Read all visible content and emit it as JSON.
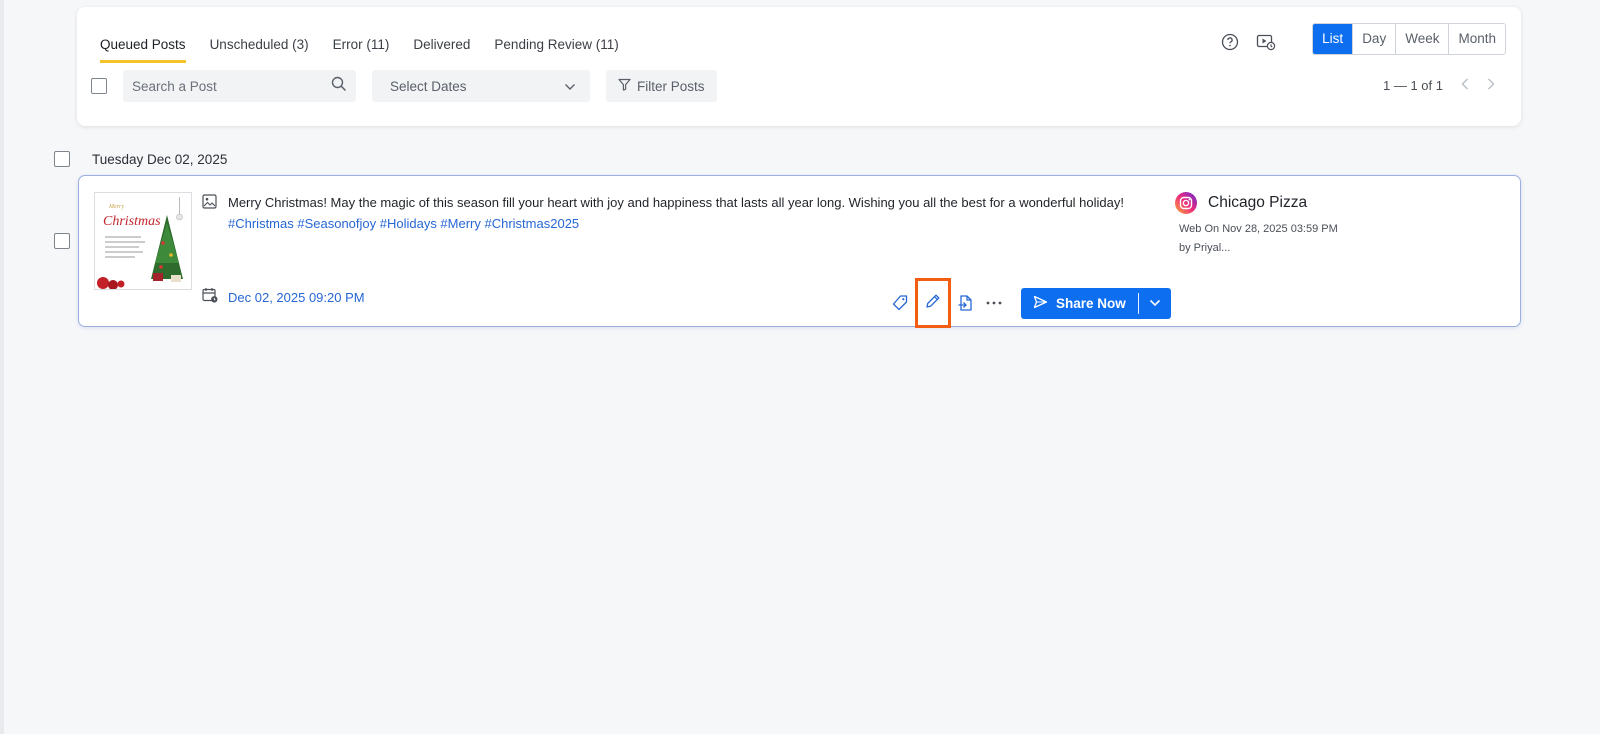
{
  "tabs": [
    {
      "label": "Queued Posts",
      "active": true
    },
    {
      "label": "Unscheduled (3)",
      "active": false
    },
    {
      "label": "Error (11)",
      "active": false
    },
    {
      "label": "Delivered",
      "active": false
    },
    {
      "label": "Pending Review (11)",
      "active": false
    }
  ],
  "views": {
    "list": "List",
    "day": "Day",
    "week": "Week",
    "month": "Month",
    "active": "List"
  },
  "search": {
    "placeholder": "Search a Post",
    "value": ""
  },
  "date_filter": {
    "placeholder": "Select Dates"
  },
  "filter_button": {
    "label": "Filter Posts"
  },
  "pagination": {
    "text": "1 — 1 of 1"
  },
  "group": {
    "date_label": "Tuesday Dec 02, 2025"
  },
  "post": {
    "caption": "Merry Christmas! May the magic of this season fill your heart with joy and happiness that lasts all year long. Wishing you all the best for a wonderful holiday!",
    "hashtags": "#Christmas #Seasonofjoy #Holidays #Merry #Christmas2025",
    "scheduled_at": "Dec 02, 2025 09:20 PM",
    "thumbnail": {
      "line1": "Merry",
      "line2": "Christmas"
    },
    "account": {
      "name": "Chicago Pizza",
      "created": "Web On Nov 28, 2025 03:59 PM",
      "author": "by Priyal..."
    },
    "share_label": "Share Now"
  },
  "colors": {
    "accent": "#0d6ef0",
    "tab_underline": "#f5c32c",
    "highlight": "#f25d12",
    "link": "#2767d4"
  }
}
